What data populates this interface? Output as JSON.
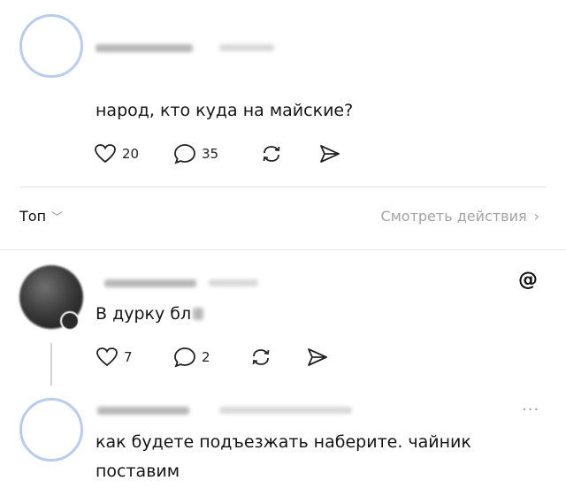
{
  "post": {
    "text": "народ, кто куда на майские?",
    "likes": "20",
    "comments": "35"
  },
  "sort_bar": {
    "sort_label": "Топ",
    "chevron": "﹀",
    "view_activity_label": "Смотреть действия",
    "view_activity_chevron": "›"
  },
  "reply1": {
    "text": "В дурку бл",
    "likes": "7",
    "comments": "2",
    "logo_glyph": "@"
  },
  "reply2": {
    "text_line1": "как будете подъезжать наберите. чайник",
    "text_line2": "поставим",
    "more_glyph": "..."
  },
  "icons": [
    "heart-icon",
    "comment-icon",
    "repost-icon",
    "share-icon",
    "threads-logo-icon",
    "more-icon"
  ],
  "colors": {
    "avatar_ring": "#b9ccec",
    "muted_text": "#a3a3a3",
    "divider": "#e6e6e6"
  }
}
